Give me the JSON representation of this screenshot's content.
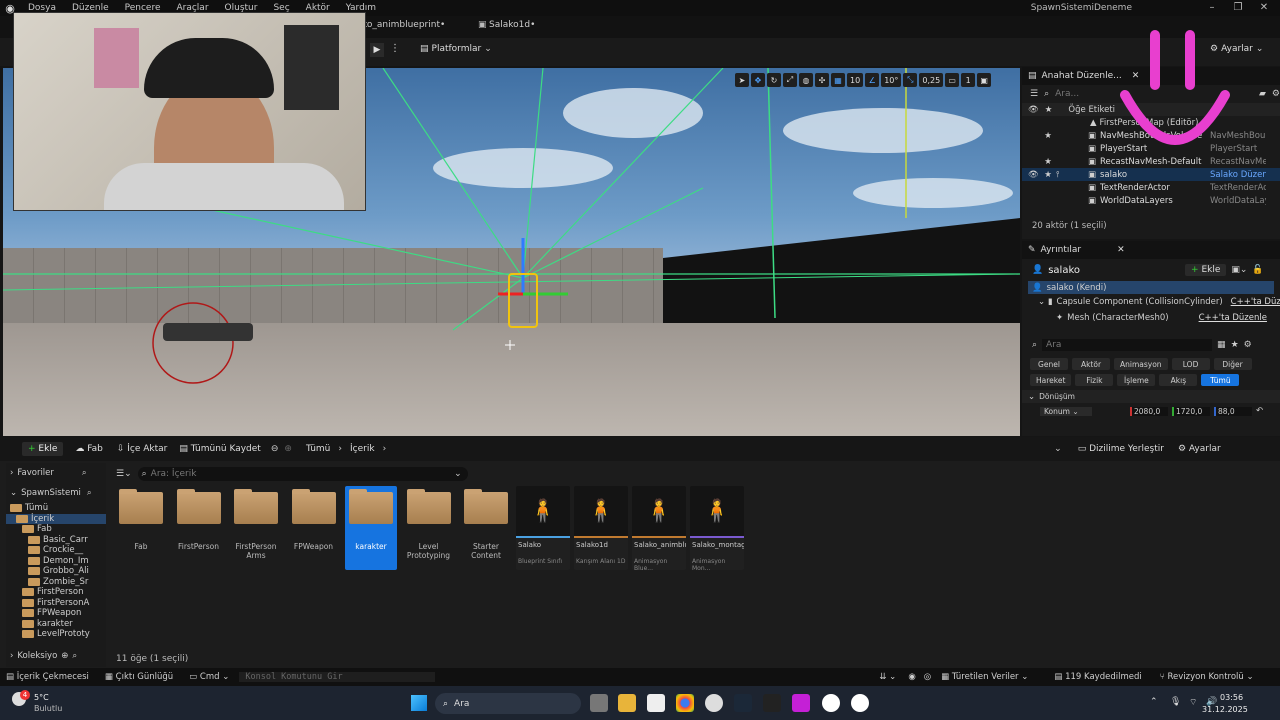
{
  "menu": [
    "Dosya",
    "Düzenle",
    "Pencere",
    "Araçlar",
    "Oluştur",
    "Seç",
    "Aktör",
    "Yardım"
  ],
  "window_title": "SpawnSistemiDeneme",
  "tabs": {
    "tab1": "ko_animblueprint•",
    "tab2": "Salako1d•"
  },
  "toolbar": {
    "platforms": "Platformlar",
    "settings": "Ayarlar"
  },
  "viewport_tools": {
    "grid": "10",
    "angle": "10°",
    "scale": "0,25",
    "cam": "1"
  },
  "outliner": {
    "title": "Anahat Düzenle...",
    "search_placeholder": "Ara...",
    "col_label": "Öğe Etiketi",
    "folder": "FirstPersonMap (Editör)",
    "rows": [
      {
        "name": "NavMeshBoundsVolume",
        "type": "NavMeshBou"
      },
      {
        "name": "PlayerStart",
        "type": "PlayerStart"
      },
      {
        "name": "RecastNavMesh-Default",
        "type": "RecastNavMe"
      },
      {
        "name": "salako",
        "type": "Salako Düzen"
      },
      {
        "name": "TextRenderActor",
        "type": "TextRenderAc"
      },
      {
        "name": "WorldDataLayers",
        "type": "WorldDataLay"
      }
    ],
    "footer": "20 aktör (1 seçili)"
  },
  "details": {
    "title": "Ayrıntılar",
    "actor": "salako",
    "add": "Ekle",
    "root": "salako (Kendi)",
    "comp1": "Capsule Component (CollisionCylinder)",
    "comp1_link": "C++'ta Düzen",
    "comp2": "Mesh (CharacterMesh0)",
    "comp2_link": "C++'ta Düzenle",
    "search_placeholder": "Ara",
    "chips_row1": [
      "Genel",
      "Aktör",
      "Animasyon",
      "LOD",
      "Diğer"
    ],
    "chips_row2": [
      "Hareket",
      "Fizik",
      "İşleme",
      "Akış",
      "Tümü"
    ],
    "section": "Dönüşüm",
    "location_label": "Konum",
    "loc": [
      "2080,0",
      "1720,0",
      "88,0"
    ]
  },
  "cb": {
    "add": "Ekle",
    "fab": "Fab",
    "import": "İçe Aktar",
    "saveall": "Tümünü Kaydet",
    "crumb_all": "Tümü",
    "crumb_content": "İçerik",
    "dock": "Dizilime Yerleştir",
    "settings": "Ayarlar",
    "favorites": "Favoriler",
    "project": "SpawnSistemi",
    "tree": [
      "Tümü",
      "İçerik",
      "Fab",
      "Basic_Carr",
      "Crockie__",
      "Demon_Im",
      "Grobbo_Ali",
      "Zombie_Sr",
      "FirstPerson",
      "FirstPersonA",
      "FPWeapon",
      "karakter",
      "LevelPrototy"
    ],
    "collections": "Koleksiyo",
    "search_placeholder": "Ara: İçerik",
    "folders": [
      "Fab",
      "FirstPerson",
      "FirstPerson Arms",
      "FPWeapon",
      "karakter",
      "Level Prototyping",
      "Starter Content"
    ],
    "assets": [
      {
        "name": "Salako",
        "type": "Blueprint Sınıfı",
        "color": "#4aa0e0"
      },
      {
        "name": "Salako1d",
        "type": "Karışım Alanı 1D",
        "color": "#c07a30"
      },
      {
        "name": "Salako_animblueprint",
        "type": "Animasyon Blue...",
        "color": "#c07a30"
      },
      {
        "name": "Salako_montage",
        "type": "Animasyon Mon...",
        "color": "#7a5ad0"
      }
    ],
    "count": "11 öğe (1 seçili)"
  },
  "status": {
    "drawer": "İçerik Çekmecesi",
    "log": "Çıktı Günlüğü",
    "cmd": "Cmd",
    "console_placeholder": "Konsol Komutunu Gir",
    "derived": "Türetilen Veriler",
    "unsaved": "119 Kaydedilmedi",
    "revision": "Revizyon Kontrolü"
  },
  "taskbar": {
    "temp": "5°C",
    "weather": "Bulutlu",
    "search": "Ara",
    "time": "03:56",
    "date": "31.12.2025",
    "notif": "4"
  }
}
